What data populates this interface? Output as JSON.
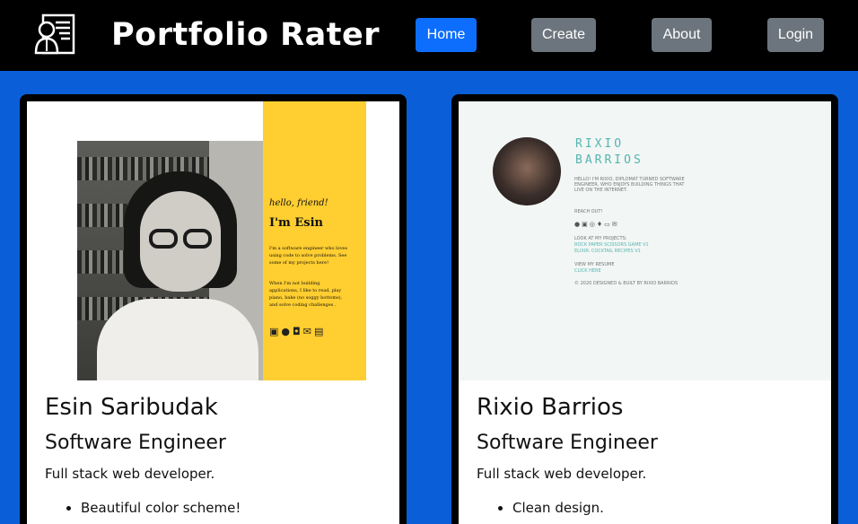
{
  "navbar": {
    "brand": "Portfolio Rater",
    "buttons": {
      "home": "Home",
      "create": "Create",
      "about": "About",
      "login": "Login"
    },
    "colors": {
      "background": "#000000",
      "primary": "#0d6efd",
      "secondary": "#6c757d"
    },
    "logo_icon": "resume-document-icon"
  },
  "page": {
    "background": "#0a5fd9"
  },
  "cards": [
    {
      "name": "Esin Saribudak",
      "role": "Software Engineer",
      "description": "Full stack web developer.",
      "highlights": [
        "Beautiful color scheme!"
      ],
      "thumbnail": {
        "greeting": "hello, friend!",
        "heading": "I'm Esin",
        "para1": "I'm a software engineer who loves using code to solve problems. See some of my projects here!",
        "para2": "When I'm not building applications, I like to read, play piano, bake (no soggy bottoms), and solve coding challenges .",
        "accent": "#ffce30"
      }
    },
    {
      "name": "Rixio Barrios",
      "role": "Software Engineer",
      "description": "Full stack web developer.",
      "highlights": [
        "Clean design."
      ],
      "thumbnail": {
        "title_line1": "RIXIO",
        "title_line2": "BARRIOS",
        "intro": "HELLO! I'M RIXIO, DIPLOMAT TURNED SOFTWARE ENGINEER, WHO ENJOYS BUILDING THINGS THAT LIVE ON THE INTERNET.",
        "reach_out": "REACH OUT!",
        "projects_label": "LOOK AT MY PROJECTS:",
        "project1": "ROCK PAPER SCISSORS GAME V1",
        "project2": "ELIXIR: COCKTAIL RECIPES V1",
        "resume_label": "VIEW MY RESUME",
        "resume_link": "CLICK HERE",
        "footer": "© 2020 DESIGNED & BUILT BY RIXIO BARRIOS",
        "accent": "#55b5b0"
      }
    }
  ]
}
